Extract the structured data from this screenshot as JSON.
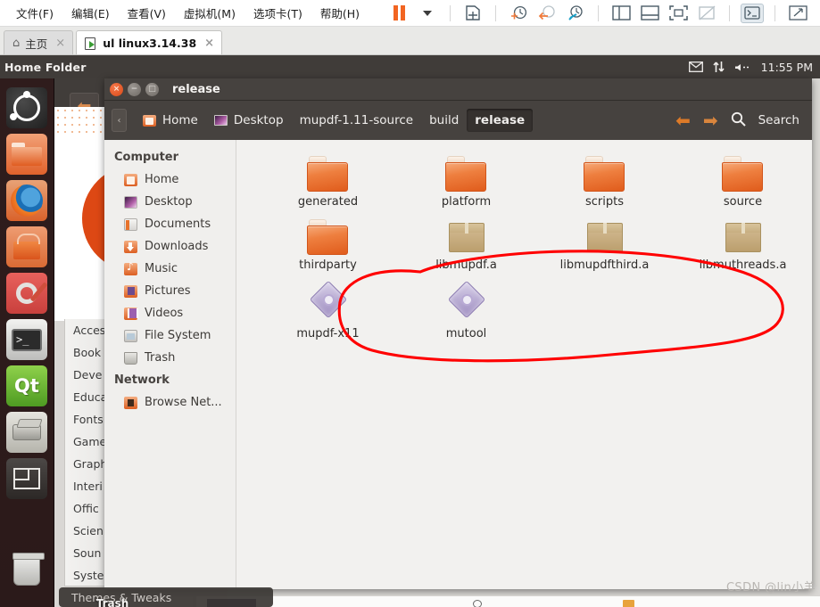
{
  "vmware": {
    "menus": [
      {
        "label": "文件(F)"
      },
      {
        "label": "编辑(E)"
      },
      {
        "label": "查看(V)"
      },
      {
        "label": "虚拟机(M)"
      },
      {
        "label": "选项卡(T)"
      },
      {
        "label": "帮助(H)"
      }
    ],
    "toolbar_icons": [
      {
        "name": "pause-icon"
      },
      {
        "name": "dropdown-caret-icon"
      },
      {
        "name": "snapshot-icon"
      },
      {
        "name": "take-snapshot-icon"
      },
      {
        "name": "revert-snapshot-icon"
      },
      {
        "name": "snapshot-manager-icon"
      },
      {
        "name": "show-sidebar-icon"
      },
      {
        "name": "show-console-icon"
      },
      {
        "name": "fullscreen-icon"
      },
      {
        "name": "unity-mode-icon"
      },
      {
        "name": "console-view-icon"
      },
      {
        "name": "stretch-view-icon"
      },
      {
        "name": "view-caret-icon"
      }
    ],
    "tabs": [
      {
        "label": "主页",
        "icon": "home-icon",
        "active": false,
        "close": "×"
      },
      {
        "label": "ul linux3.14.38",
        "icon": "vm-running-icon",
        "active": true,
        "close": "×"
      }
    ]
  },
  "ubuntu_panel": {
    "title": "Home Folder",
    "indicators": [
      {
        "name": "messaging-icon",
        "glyph": "✉"
      },
      {
        "name": "network-icon",
        "glyph": "⇅"
      },
      {
        "name": "volume-icon",
        "glyph": "◀"
      }
    ],
    "clock": "11:55 PM"
  },
  "launcher": {
    "items": [
      {
        "name": "launcher-ubuntu-dash",
        "label": "Dash Home"
      },
      {
        "name": "launcher-files",
        "label": "Files"
      },
      {
        "name": "launcher-firefox",
        "label": "Firefox Web Browser"
      },
      {
        "name": "launcher-software-center",
        "label": "Ubuntu Software Center"
      },
      {
        "name": "launcher-settings",
        "label": "System Settings"
      },
      {
        "name": "launcher-terminal",
        "label": "Terminal"
      },
      {
        "name": "launcher-qt-creator",
        "label": "Qt Creator"
      },
      {
        "name": "launcher-scanner",
        "label": "Simple Scan"
      },
      {
        "name": "launcher-workspace-switcher",
        "label": "Workspace Switcher"
      },
      {
        "name": "launcher-trash",
        "label": "Trash"
      }
    ],
    "trash_label": "Trash"
  },
  "behind_window": {
    "tooltip": "Themes & Tweaks",
    "menu_items": [
      "Acces",
      "Book",
      "Deve",
      "Educa",
      "Fonts",
      "Game",
      "Graph",
      "Interi",
      "Offic",
      "Scien",
      "Soun",
      "Syste"
    ]
  },
  "file_manager": {
    "window_title": "release",
    "window_buttons": {
      "close": "×",
      "minimize": "−",
      "maximize": "□"
    },
    "breadcrumbs": [
      {
        "label": "Home",
        "icon": "home-folder-icon",
        "current": false
      },
      {
        "label": "Desktop",
        "icon": "desktop-icon",
        "current": false
      },
      {
        "label": "mupdf-1.11-source",
        "icon": "",
        "current": false
      },
      {
        "label": "build",
        "icon": "",
        "current": false
      },
      {
        "label": "release",
        "icon": "",
        "current": true
      }
    ],
    "nav": {
      "back": "⬅",
      "forward": "➡",
      "search_label": "Search",
      "search_icon": "search-icon"
    },
    "sidebar": {
      "sections": [
        {
          "heading": "Computer",
          "items": [
            {
              "label": "Home",
              "icon": "home-icon"
            },
            {
              "label": "Desktop",
              "icon": "desktop-icon"
            },
            {
              "label": "Documents",
              "icon": "documents-icon"
            },
            {
              "label": "Downloads",
              "icon": "downloads-icon"
            },
            {
              "label": "Music",
              "icon": "music-icon"
            },
            {
              "label": "Pictures",
              "icon": "pictures-icon"
            },
            {
              "label": "Videos",
              "icon": "videos-icon"
            },
            {
              "label": "File System",
              "icon": "filesystem-icon"
            },
            {
              "label": "Trash",
              "icon": "trash-icon"
            }
          ]
        },
        {
          "heading": "Network",
          "items": [
            {
              "label": "Browse Net...",
              "icon": "network-browse-icon"
            }
          ]
        }
      ]
    },
    "files": [
      {
        "label": "generated",
        "type": "folder",
        "highlighted": false
      },
      {
        "label": "platform",
        "type": "folder",
        "highlighted": false
      },
      {
        "label": "scripts",
        "type": "folder",
        "highlighted": false
      },
      {
        "label": "source",
        "type": "folder",
        "highlighted": false
      },
      {
        "label": "thirdparty",
        "type": "folder",
        "highlighted": false
      },
      {
        "label": "libmupdf.a",
        "type": "archive",
        "highlighted": true
      },
      {
        "label": "libmupdfthird.a",
        "type": "archive",
        "highlighted": true
      },
      {
        "label": "libmuthreads.a",
        "type": "archive",
        "highlighted": true
      },
      {
        "label": "mupdf-x11",
        "type": "executable",
        "highlighted": false
      },
      {
        "label": "mutool",
        "type": "executable",
        "highlighted": false
      }
    ],
    "annotation": {
      "name": "red-circle-annotation",
      "color": "#ff0000"
    }
  },
  "watermark": "CSDN @lin小羊",
  "colors": {
    "ubuntu_orange": "#dd4814",
    "panel_dark": "#403c39",
    "window_dark": "#46423f",
    "annotation_red": "#ff0000",
    "folder_orange": "#e05c1c",
    "archive_tan": "#c7ae80",
    "exec_purple": "#9d8cc0"
  }
}
